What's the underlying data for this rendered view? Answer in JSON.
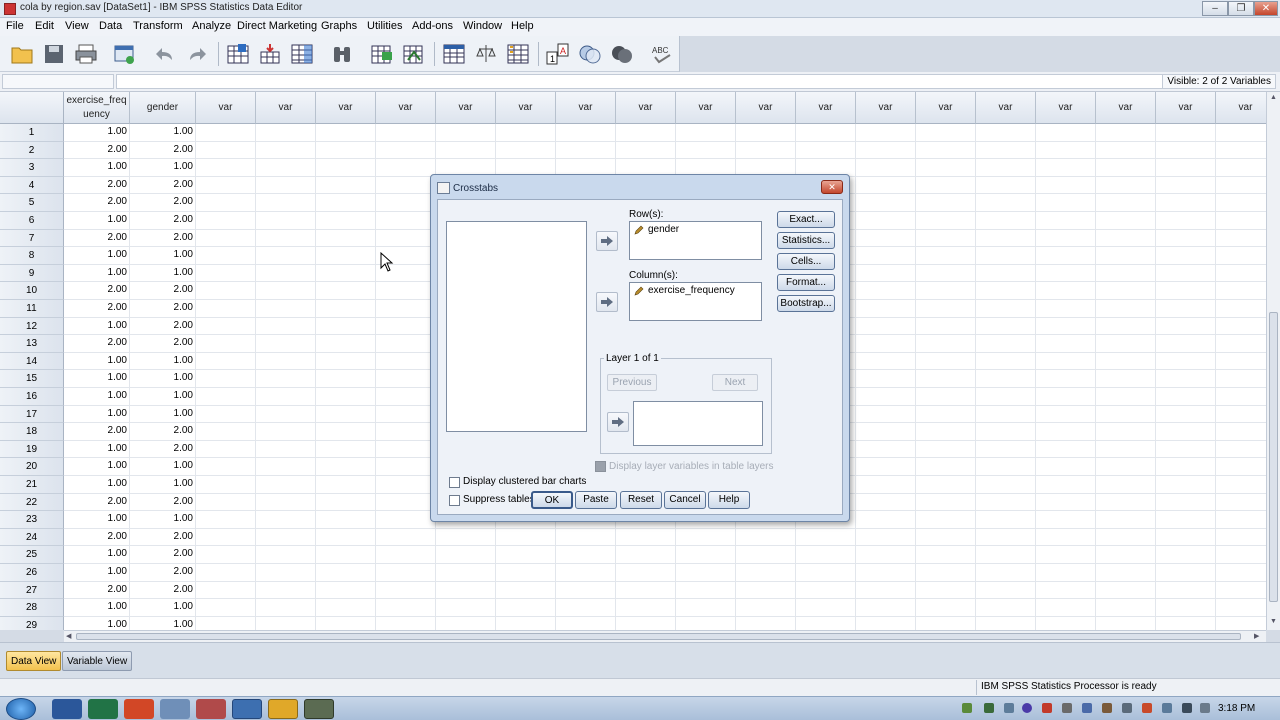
{
  "window": {
    "title": "cola by region.sav [DataSet1] - IBM SPSS Statistics Data Editor"
  },
  "menu": [
    "File",
    "Edit",
    "View",
    "Data",
    "Transform",
    "Analyze",
    "Direct Marketing",
    "Graphs",
    "Utilities",
    "Add-ons",
    "Window",
    "Help"
  ],
  "editrow": {
    "visible": "Visible: 2 of 2 Variables"
  },
  "grid": {
    "columns": [
      "exercise_frequency",
      "gender",
      "var",
      "var",
      "var",
      "var",
      "var",
      "var",
      "var",
      "var",
      "var",
      "var",
      "var",
      "var",
      "var",
      "var",
      "var",
      "var",
      "var",
      "var"
    ],
    "rows": [
      [
        "1",
        "1.00",
        "1.00"
      ],
      [
        "2",
        "2.00",
        "2.00"
      ],
      [
        "3",
        "1.00",
        "1.00"
      ],
      [
        "4",
        "2.00",
        "2.00"
      ],
      [
        "5",
        "2.00",
        "2.00"
      ],
      [
        "6",
        "1.00",
        "2.00"
      ],
      [
        "7",
        "2.00",
        "2.00"
      ],
      [
        "8",
        "1.00",
        "1.00"
      ],
      [
        "9",
        "1.00",
        "1.00"
      ],
      [
        "10",
        "2.00",
        "2.00"
      ],
      [
        "11",
        "2.00",
        "2.00"
      ],
      [
        "12",
        "1.00",
        "2.00"
      ],
      [
        "13",
        "2.00",
        "2.00"
      ],
      [
        "14",
        "1.00",
        "1.00"
      ],
      [
        "15",
        "1.00",
        "1.00"
      ],
      [
        "16",
        "1.00",
        "1.00"
      ],
      [
        "17",
        "1.00",
        "1.00"
      ],
      [
        "18",
        "2.00",
        "2.00"
      ],
      [
        "19",
        "1.00",
        "2.00"
      ],
      [
        "20",
        "1.00",
        "1.00"
      ],
      [
        "21",
        "1.00",
        "1.00"
      ],
      [
        "22",
        "2.00",
        "2.00"
      ],
      [
        "23",
        "1.00",
        "1.00"
      ],
      [
        "24",
        "2.00",
        "2.00"
      ],
      [
        "25",
        "1.00",
        "2.00"
      ],
      [
        "26",
        "1.00",
        "2.00"
      ],
      [
        "27",
        "2.00",
        "2.00"
      ],
      [
        "28",
        "1.00",
        "1.00"
      ],
      [
        "29",
        "1.00",
        "1.00"
      ]
    ]
  },
  "tabs": {
    "data_view": "Data View",
    "variable_view": "Variable View"
  },
  "status": {
    "processor": "IBM SPSS Statistics Processor is ready"
  },
  "clock": "3:18 PM",
  "dialog": {
    "title": "Crosstabs",
    "rows_label": "Row(s):",
    "rows_item": "gender",
    "columns_label": "Column(s):",
    "columns_item": "exercise_frequency",
    "layer_label": "Layer 1 of 1",
    "previous": "Previous",
    "next": "Next",
    "display_layer": "Display layer variables in table layers",
    "clustered": "Display clustered bar charts",
    "suppress": "Suppress tables",
    "side_buttons": {
      "exact": "Exact...",
      "statistics": "Statistics...",
      "cells": "Cells...",
      "format": "Format...",
      "bootstrap": "Bootstrap..."
    },
    "ok": "OK",
    "paste": "Paste",
    "reset": "Reset",
    "cancel": "Cancel",
    "help": "Help"
  }
}
